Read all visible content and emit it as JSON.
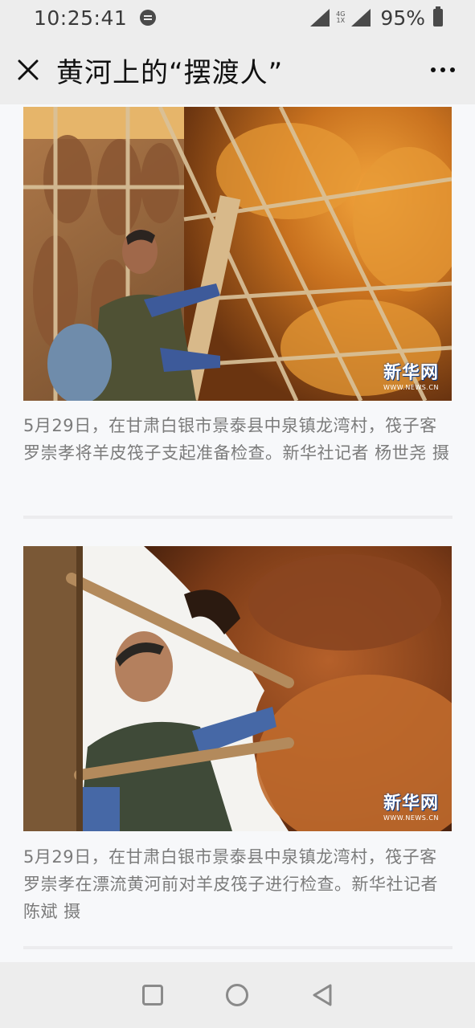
{
  "status_bar": {
    "time": "10:25:41",
    "network_top": "4G",
    "network_bottom": "1X",
    "battery": "95%"
  },
  "nav": {
    "title": "黄河上的“摆渡人”",
    "close_icon": "close-icon",
    "more_icon": "more-icon"
  },
  "article": {
    "photos": [
      {
        "watermark_logo": "新华网",
        "watermark_url": "WWW.NEWS.CN",
        "caption": "5月29日，在甘肃白银市景泰县中泉镇龙湾村，筏子客罗崇孝将羊皮筏子支起准备检查。新华社记者 杨世尧 摄"
      },
      {
        "watermark_logo": "新华网",
        "watermark_url": "WWW.NEWS.CN",
        "caption": "5月29日，在甘肃白银市景泰县中泉镇龙湾村，筏子客罗崇孝在漂流黄河前对羊皮筏子进行检查。新华社记者 陈斌 摄"
      }
    ]
  },
  "android_nav": {
    "recents_icon": "recents-icon",
    "home_icon": "home-icon",
    "back_icon": "back-icon"
  }
}
